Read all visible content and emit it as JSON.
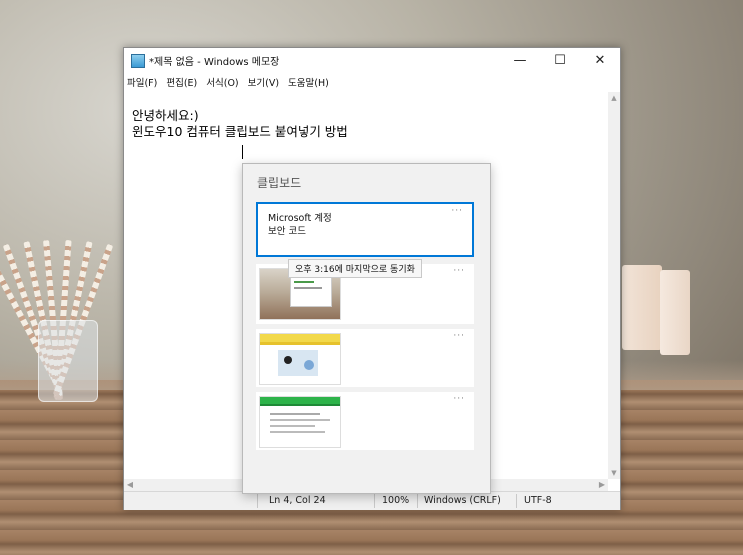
{
  "window": {
    "title": "*제목 없음 - Windows 메모장",
    "controls": {
      "minimize": "—",
      "maximize": "☐",
      "close": "✕"
    }
  },
  "menu": [
    "파일(F)",
    "편집(E)",
    "서식(O)",
    "보기(V)",
    "도움말(H)"
  ],
  "editor": {
    "lines": [
      "안녕하세요:)",
      "윈도우10 컴퓨터 클립보드 붙여넣기 방법"
    ]
  },
  "statusbar": {
    "position": "Ln 4, Col 24",
    "zoom": "100%",
    "line_ending": "Windows (CRLF)",
    "encoding": "UTF-8"
  },
  "clipboard": {
    "title": "클립보드",
    "items": [
      {
        "type": "text",
        "lines": [
          "Microsoft 계정",
          "보안 코드"
        ],
        "more": "···",
        "selected": true
      },
      {
        "type": "image",
        "theme": "photo-desk",
        "more": "···"
      },
      {
        "type": "image",
        "theme": "yellow-page",
        "more": "···"
      },
      {
        "type": "image",
        "theme": "green-page",
        "more": "···"
      }
    ],
    "tooltip": "오후 3:16에 마지막으로 동기화"
  },
  "colors": {
    "accent": "#0078d7",
    "panel": "#f1f1f1"
  }
}
